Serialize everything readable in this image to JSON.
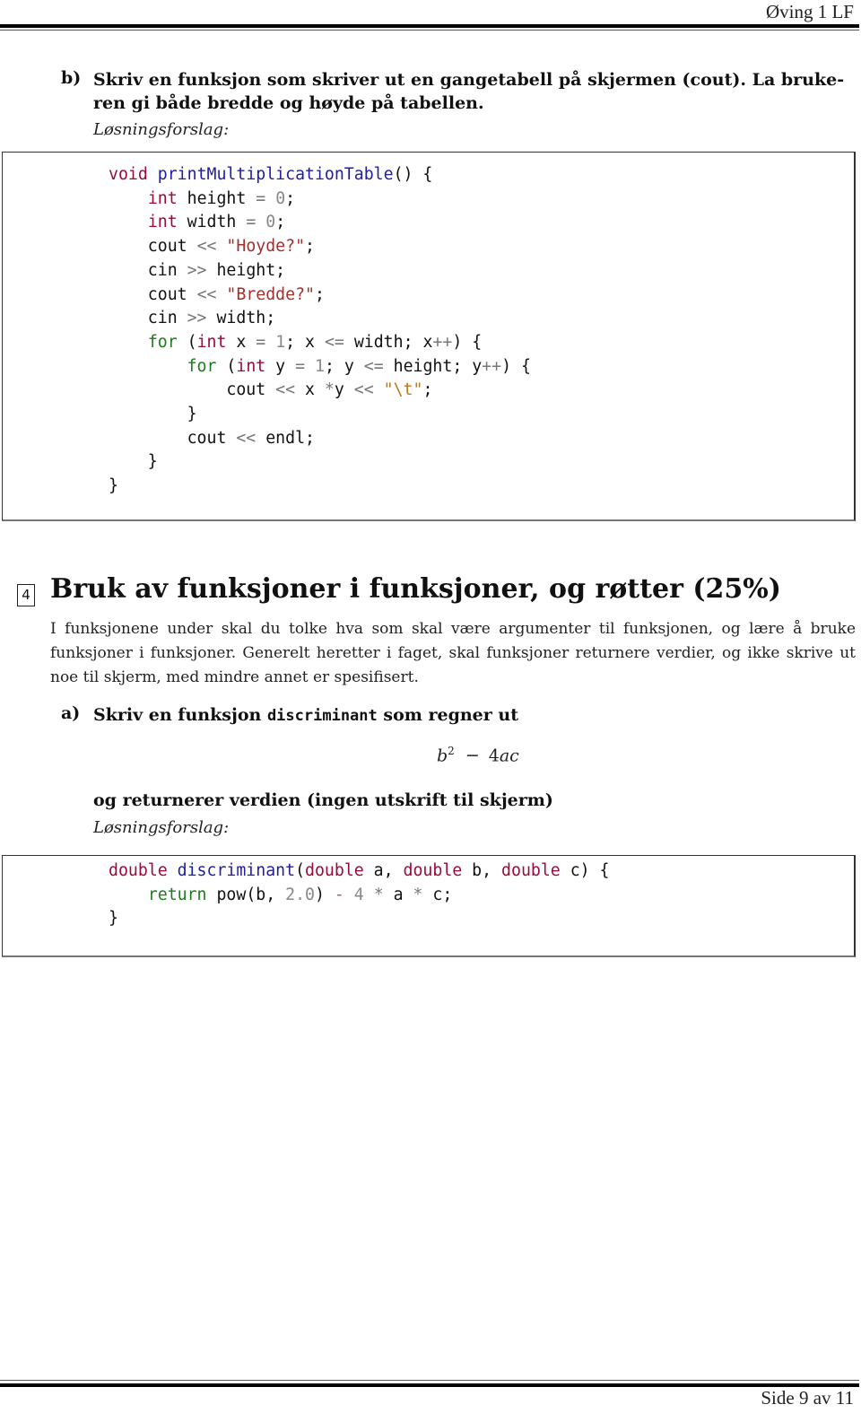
{
  "header": {
    "title": "Øving 1 LF"
  },
  "part_b": {
    "label": "b)",
    "line1": "Skriv en funksjon som skriver ut en gangetabell på skjermen (cout). La bruke-",
    "line2": "ren gi både bredde og høyde på tabellen.",
    "solution_label": "Løsningsforslag:",
    "code_lines": [
      "void printMultiplicationTable() {",
      "    int height = 0;",
      "    int width = 0;",
      "    cout << \"Hoyde?\";",
      "    cin >> height;",
      "    cout << \"Bredde?\";",
      "    cin >> width;",
      "    for (int x = 1; x <= width; x++) {",
      "        for (int y = 1; y <= height; y++) {",
      "            cout << x *y << \"\\t\";",
      "        }",
      "        cout << endl;",
      "    }",
      "}"
    ]
  },
  "section4": {
    "number": "4",
    "title": "Bruk av funksjoner i funksjoner, og røtter (25%)",
    "intro": "I funksjonene under skal du tolke hva som skal være argumenter til funksjonen, og lære å bruke funksjoner i funksjoner. Generelt heretter i faget, skal funksjoner returnere verdier, og ikke skrive ut noe til skjerm, med mindre annet er spesifisert."
  },
  "part_a": {
    "label": "a)",
    "prompt_before": "Skriv en funksjon ",
    "prompt_code": "discriminant",
    "prompt_after": " som regner ut",
    "formula": {
      "base": "b",
      "exponent": "2",
      "minus": "−",
      "coefficient": "4",
      "vars": "ac"
    },
    "follow_up": "og returnerer verdien (ingen utskrift til skjerm)",
    "solution_label": "Løsningsforslag:",
    "code_lines": [
      "double discriminant(double a, double b, double c) {",
      "    return pow(b, 2.0) - 4 * a * c;",
      "}"
    ]
  },
  "footer": {
    "page_text": "Side 9 av 11"
  },
  "syntax_colors": {
    "type_keyword": "#9b0a3e",
    "control_keyword": "#1e7a1e",
    "function_name": "#1f1ea0",
    "number": "#888888",
    "string": "#a3302e",
    "escape": "#c0761c"
  }
}
